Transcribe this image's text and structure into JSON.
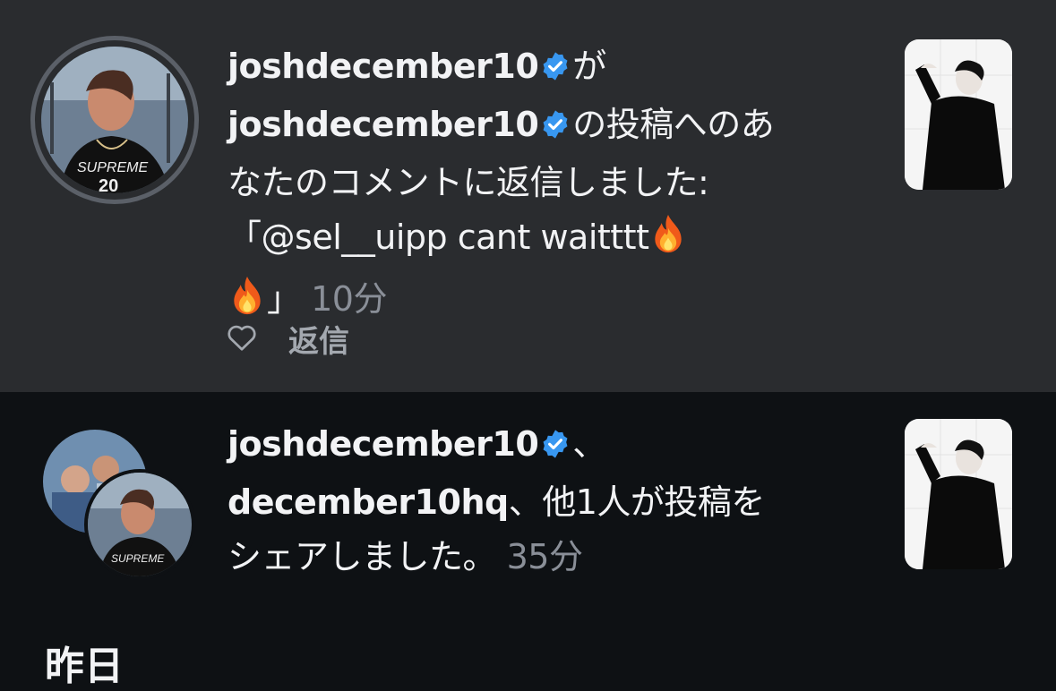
{
  "notification_1": {
    "username_a": "joshdecember10",
    "connector": "が",
    "username_b": "joshdecember10",
    "message_a": "の投稿へのあ",
    "message_b": "なたのコメントに返信しました:",
    "quote_open": "「",
    "quote_text": "@sel__uipp cant waitttt",
    "fire_emoji": "🔥",
    "quote_close": "」",
    "time": "10分",
    "reply_label": "返信"
  },
  "notification_2": {
    "username_a": "joshdecember10",
    "separator": "、",
    "username_b": "december10hq",
    "message_a": "、他1人が投稿を",
    "message_b": "シェアしました。",
    "time": "35分"
  },
  "section_header": "昨日",
  "colors": {
    "verified_badge": "#3897f0",
    "highlight_background": "#2a2c2f",
    "page_background": "#0e1114",
    "muted_text": "#8a8f98"
  }
}
